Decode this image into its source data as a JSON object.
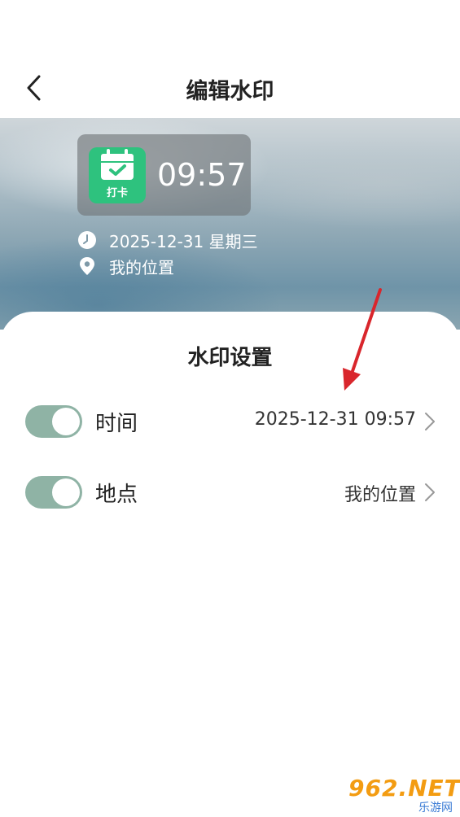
{
  "header": {
    "title": "编辑水印"
  },
  "preview": {
    "app_icon_label": "打卡",
    "time": "09:57",
    "date_line": "2025-12-31 星期三",
    "location_line": "我的位置"
  },
  "settings": {
    "title": "水印设置",
    "items": [
      {
        "label": "时间",
        "value": "2025-12-31 09:57",
        "enabled": true
      },
      {
        "label": "地点",
        "value": "我的位置",
        "enabled": true
      }
    ]
  },
  "site_watermark": {
    "main": "962.NET",
    "sub": "乐游网"
  },
  "colors": {
    "toggle_on": "#8fb3a5",
    "app_icon": "#2ec27e",
    "annotation_arrow": "#d9262c"
  }
}
